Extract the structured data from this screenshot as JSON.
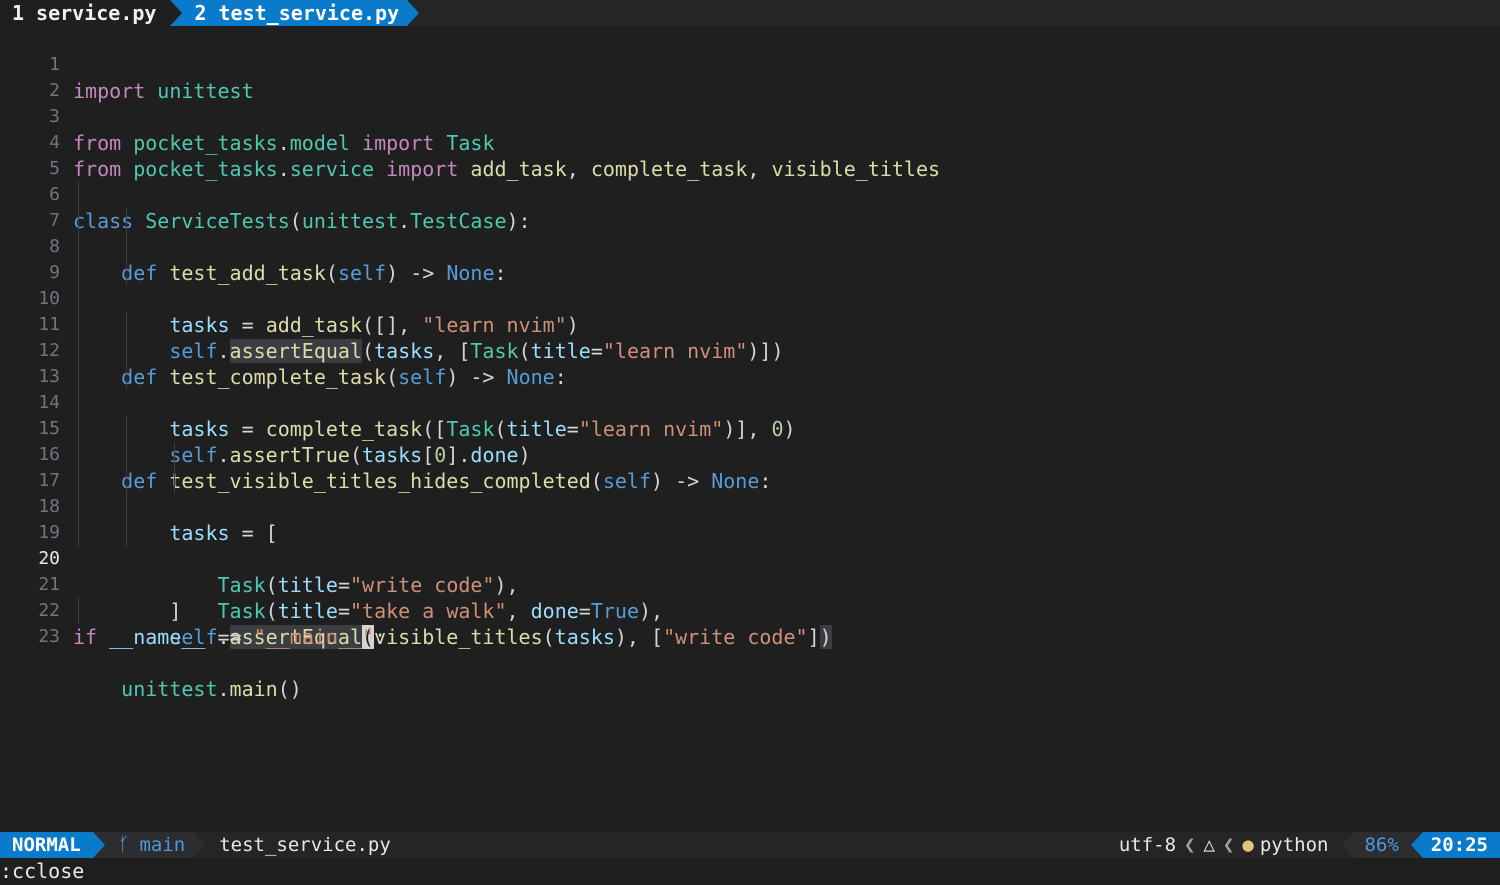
{
  "tabline": {
    "tabs": [
      {
        "number": "1",
        "name": "service.py",
        "active": false
      },
      {
        "number": "2",
        "name": "test_service.py",
        "active": true
      }
    ]
  },
  "editor": {
    "current_line": 20,
    "line_numbers": [
      "1",
      "2",
      "3",
      "4",
      "5",
      "6",
      "7",
      "8",
      "9",
      "10",
      "11",
      "12",
      "13",
      "14",
      "15",
      "16",
      "17",
      "18",
      "19",
      "20",
      "21",
      "22",
      "23"
    ],
    "lines": [
      "import unittest",
      "",
      "from pocket_tasks.model import Task",
      "from pocket_tasks.service import add_task, complete_task, visible_titles",
      "",
      "class ServiceTests(unittest.TestCase):",
      "    def test_add_task(self) -> None:",
      "        tasks = add_task([], \"learn nvim\")",
      "        self.assertEqual(tasks, [Task(title=\"learn nvim\")])",
      "",
      "    def test_complete_task(self) -> None:",
      "        tasks = complete_task([Task(title=\"learn nvim\")], 0)",
      "        self.assertTrue(tasks[0].done)",
      "",
      "    def test_visible_titles_hides_completed(self) -> None:",
      "        tasks = [",
      "            Task(title=\"write code\"),",
      "            Task(title=\"take a walk\", done=True),",
      "        ]",
      "        self.assertEqual(visible_titles(tasks), [\"write code\"])",
      "",
      "if __name__ == \"__main__\":",
      "    unittest.main()"
    ]
  },
  "statusline": {
    "mode": "NORMAL",
    "branch": "main",
    "file": "test_service.py",
    "encoding": "utf-8",
    "os_icon": "linux-penguin-icon",
    "filetype_icon": "python-icon",
    "filetype": "python",
    "percent": "86%",
    "position": "20:25"
  },
  "cmdline": {
    "text": ":cclose"
  },
  "colors": {
    "accent": "#0a7aca",
    "background": "#1f1f1f",
    "keyword": "#c586c0",
    "string": "#ce9178",
    "type": "#4ec9b0",
    "function": "#dcdcaa",
    "variable": "#9cdcfe"
  }
}
